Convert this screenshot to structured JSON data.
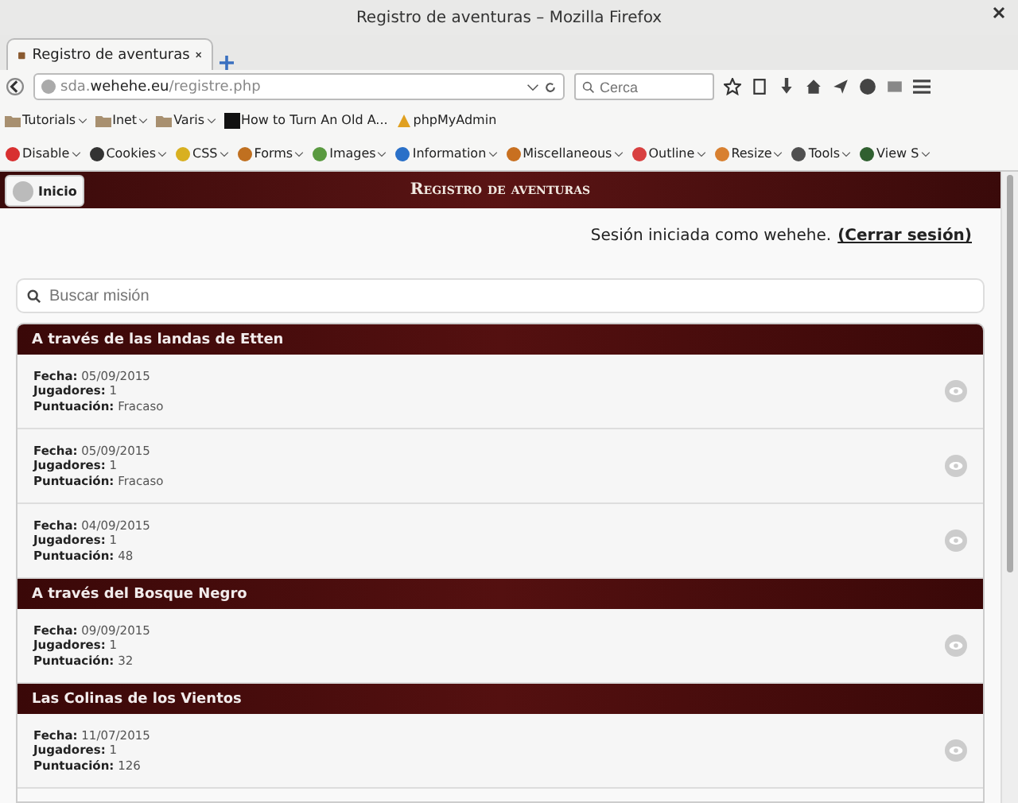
{
  "window": {
    "title": "Registro de aventuras – Mozilla Firefox"
  },
  "tabs": [
    {
      "label": "Registro de aventuras",
      "selected": true
    }
  ],
  "address": {
    "host_prefix": "sda.",
    "host": "wehehe.eu",
    "path": "/registre.php"
  },
  "search": {
    "placeholder": "Cerca"
  },
  "bookmarks": [
    {
      "kind": "folder",
      "label": "Tutorials"
    },
    {
      "kind": "folder",
      "label": "Inet"
    },
    {
      "kind": "folder",
      "label": "Varis"
    },
    {
      "kind": "site",
      "label": "How to Turn An Old A..."
    },
    {
      "kind": "pma",
      "label": "phpMyAdmin"
    }
  ],
  "devtools": [
    {
      "label": "Disable",
      "color": "#d83030"
    },
    {
      "label": "Cookies",
      "color": "#333333"
    },
    {
      "label": "CSS",
      "color": "#d8b020"
    },
    {
      "label": "Forms",
      "color": "#c07020"
    },
    {
      "label": "Images",
      "color": "#5a9a40"
    },
    {
      "label": "Information",
      "color": "#2a70c8"
    },
    {
      "label": "Miscellaneous",
      "color": "#c87020"
    },
    {
      "label": "Outline",
      "color": "#d84040"
    },
    {
      "label": "Resize",
      "color": "#d88030"
    },
    {
      "label": "Tools",
      "color": "#505050"
    },
    {
      "label": "View S",
      "color": "#306030"
    }
  ],
  "page": {
    "home_button": "Inicio",
    "title": "Registro de aventuras",
    "session_text": "Sesión iniciada como wehehe.",
    "logout_link": "(Cerrar sesión)",
    "search_placeholder": "Buscar misión",
    "groups": [
      {
        "title": "A través de las landas de Etten",
        "entries": [
          {
            "date_label": "Fecha:",
            "date": "05/09/2015",
            "players_label": "Jugadores:",
            "players": "1",
            "score_label": "Puntuación:",
            "score": "Fracaso"
          },
          {
            "date_label": "Fecha:",
            "date": "05/09/2015",
            "players_label": "Jugadores:",
            "players": "1",
            "score_label": "Puntuación:",
            "score": "Fracaso"
          },
          {
            "date_label": "Fecha:",
            "date": "04/09/2015",
            "players_label": "Jugadores:",
            "players": "1",
            "score_label": "Puntuación:",
            "score": "48"
          }
        ]
      },
      {
        "title": "A través del Bosque Negro",
        "entries": [
          {
            "date_label": "Fecha:",
            "date": "09/09/2015",
            "players_label": "Jugadores:",
            "players": "1",
            "score_label": "Puntuación:",
            "score": "32"
          }
        ]
      },
      {
        "title": "Las Colinas de los Vientos",
        "entries": [
          {
            "date_label": "Fecha:",
            "date": "11/07/2015",
            "players_label": "Jugadores:",
            "players": "1",
            "score_label": "Puntuación:",
            "score": "126"
          }
        ]
      }
    ]
  }
}
